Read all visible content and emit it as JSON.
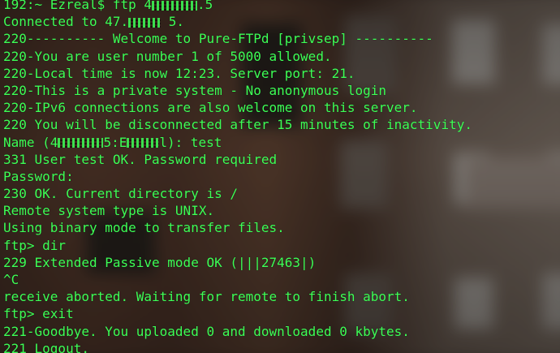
{
  "terminal": {
    "lines": [
      {
        "pre": "192:~ Ezreal$ ftp 4",
        "post": ".5"
      },
      {
        "pre": "Connected to 47.",
        "post": " 5."
      },
      {
        "text": "220---------- Welcome to Pure-FTPd [privsep] ----------"
      },
      {
        "text": "220-You are user number 1 of 5000 allowed."
      },
      {
        "text": "220-Local time is now 12:23. Server port: 21."
      },
      {
        "text": "220-This is a private system - No anonymous login"
      },
      {
        "text": "220-IPv6 connections are also welcome on this server."
      },
      {
        "text": "220 You will be disconnected after 15 minutes of inactivity."
      },
      {
        "pre": "Name (4",
        "mid": "5:E",
        "post": "l): test"
      },
      {
        "text": "331 User test OK. Password required"
      },
      {
        "text": "Password:"
      },
      {
        "text": "230 OK. Current directory is /"
      },
      {
        "text": "Remote system type is UNIX."
      },
      {
        "text": "Using binary mode to transfer files."
      },
      {
        "text": "ftp> dir"
      },
      {
        "text": "229 Extended Passive mode OK (|||27463|)"
      },
      {
        "text": "^C"
      },
      {
        "text": "receive aborted. Waiting for remote to finish abort."
      },
      {
        "text": "ftp> exit"
      },
      {
        "text": "221-Goodbye. You uploaded 0 and downloaded 0 kbytes."
      },
      {
        "text": "221 Logout."
      }
    ]
  },
  "colors": {
    "terminal_text": "#3dff56",
    "background": "#1c1612"
  }
}
